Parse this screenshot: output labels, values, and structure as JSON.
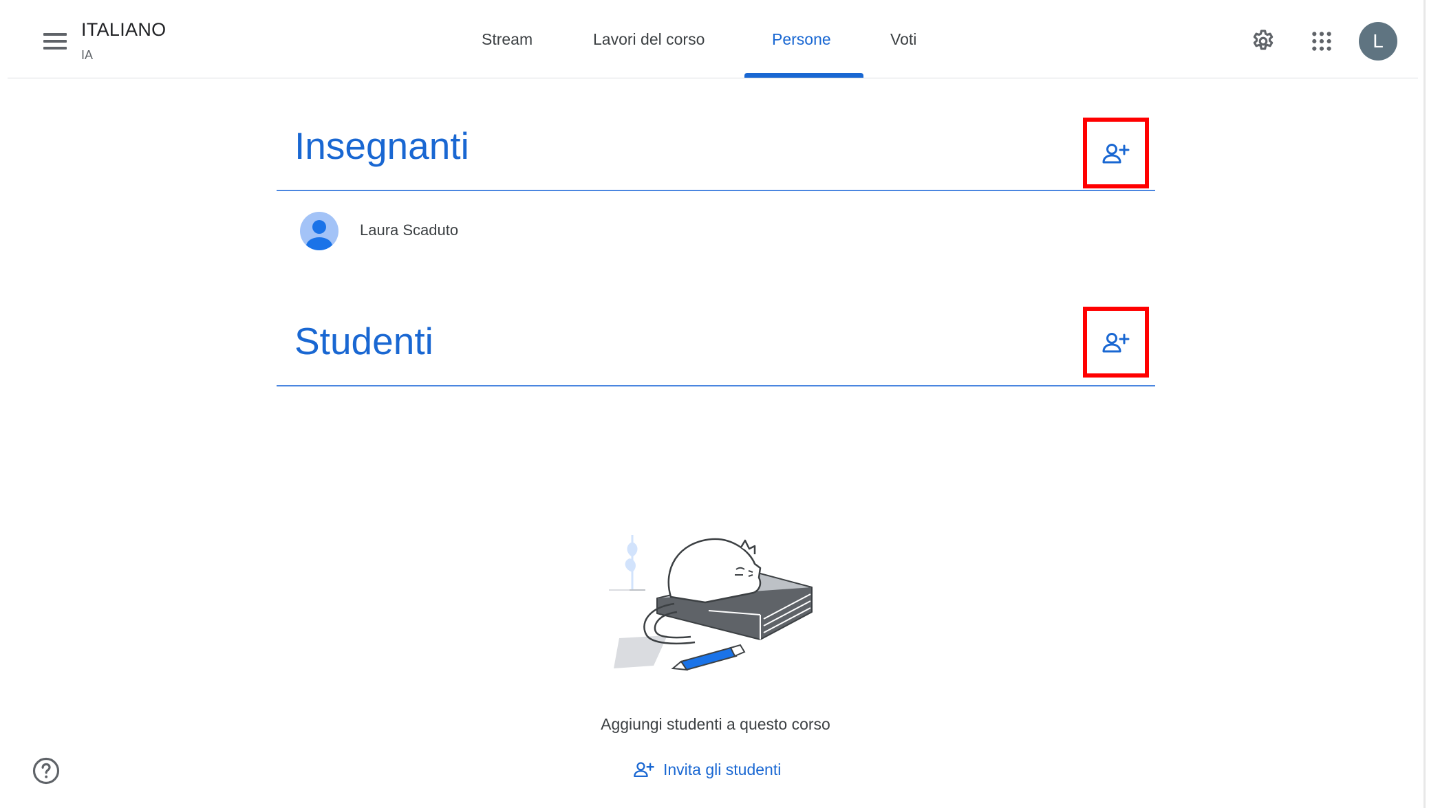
{
  "header": {
    "class_name": "ITALIANO",
    "section": "IA",
    "tabs": [
      {
        "label": "Stream",
        "active": false
      },
      {
        "label": "Lavori del corso",
        "active": false
      },
      {
        "label": "Persone",
        "active": true
      },
      {
        "label": "Voti",
        "active": false
      }
    ],
    "account_initial": "L",
    "icons": {
      "menu": "menu-icon",
      "settings": "gear-icon",
      "apps": "apps-grid-icon"
    }
  },
  "teachers": {
    "title": "Insegnanti",
    "add_icon": "person-add-icon",
    "members": [
      {
        "name": "Laura Scaduto"
      }
    ]
  },
  "students": {
    "title": "Studenti",
    "add_icon": "person-add-icon",
    "empty_message": "Aggiungi studenti a questo corso",
    "invite_label": "Invita gli studenti"
  },
  "colors": {
    "accent": "#1967d2",
    "highlight_box": "#ff0000",
    "avatar_top": "#5f7481"
  }
}
